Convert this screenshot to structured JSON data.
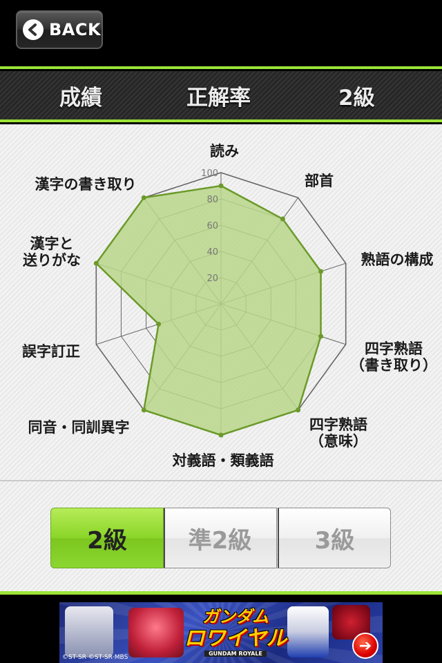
{
  "topbar": {
    "back_label": "BACK"
  },
  "header": {
    "left": "成績",
    "center": "正解率",
    "right": "2級"
  },
  "chart_data": {
    "type": "radar",
    "max": 100,
    "ticks": [
      "20",
      "40",
      "60",
      "80",
      "100"
    ],
    "tick_values": [
      20,
      40,
      60,
      80,
      100
    ],
    "axes": [
      "読み",
      "部首",
      "熟語の構成",
      "四字熟語\n（書き取り）",
      "四字熟語\n（意味）",
      "対義語・類義語",
      "同音・同訓異字",
      "誤字訂正",
      "漢字と\n送りがな",
      "漢字の書き取り"
    ],
    "series": [
      {
        "values": [
          90,
          80,
          80,
          80,
          100,
          100,
          100,
          50,
          100,
          100
        ]
      }
    ],
    "fill_color": "#b9d68a",
    "line_color": "#6b9a2a",
    "grid_color": "#666666"
  },
  "tabs": [
    {
      "label": "2級",
      "active": true
    },
    {
      "label": "準2級",
      "active": false
    },
    {
      "label": "3級",
      "active": false
    }
  ],
  "banner": {
    "title_line1": "ガンダム",
    "title_line2": "ロワイヤル",
    "subtitle": "GUNDAM ROYALE",
    "copyright": "©ST·SR ©ST·SR·MBS",
    "arrow_icon": "arrow-right-icon"
  },
  "colors": {
    "accent": "#9be438"
  }
}
